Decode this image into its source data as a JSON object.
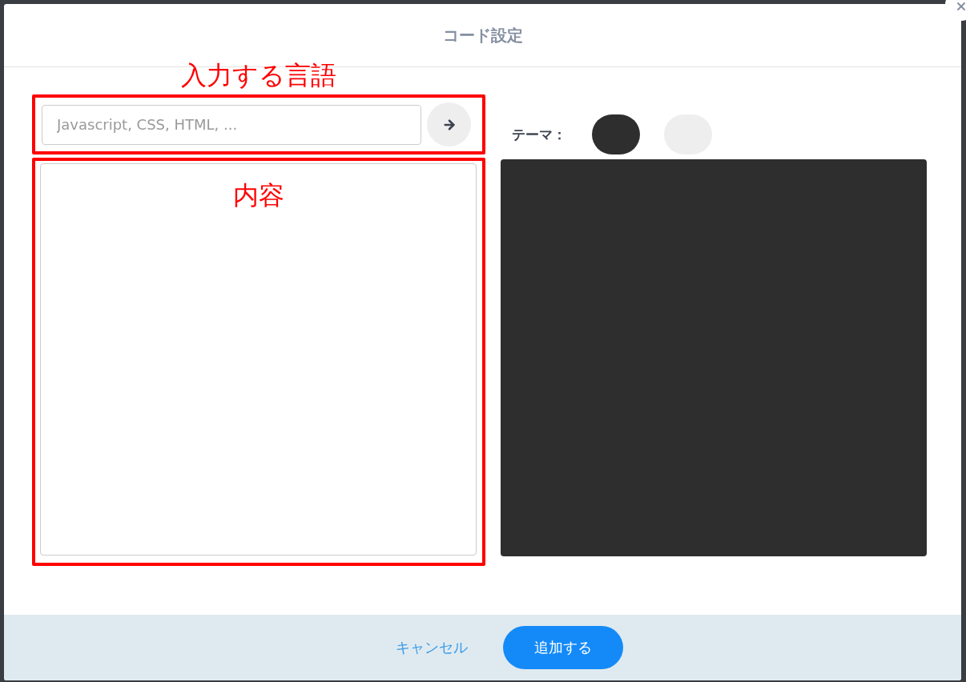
{
  "dialog": {
    "title": "コード設定"
  },
  "language_input": {
    "placeholder": "Javascript, CSS, HTML, ..."
  },
  "theme": {
    "label": "テーマ：",
    "swatches": [
      {
        "color": "#2e2e2e"
      },
      {
        "color": "#eeeeee"
      }
    ]
  },
  "annotations": [
    {
      "text": "入力する言語"
    },
    {
      "text": "内容"
    }
  ],
  "footer": {
    "buttons": [
      {
        "label": "キャンセル",
        "kind": "link"
      },
      {
        "label": "追加する",
        "kind": "primary"
      }
    ]
  }
}
